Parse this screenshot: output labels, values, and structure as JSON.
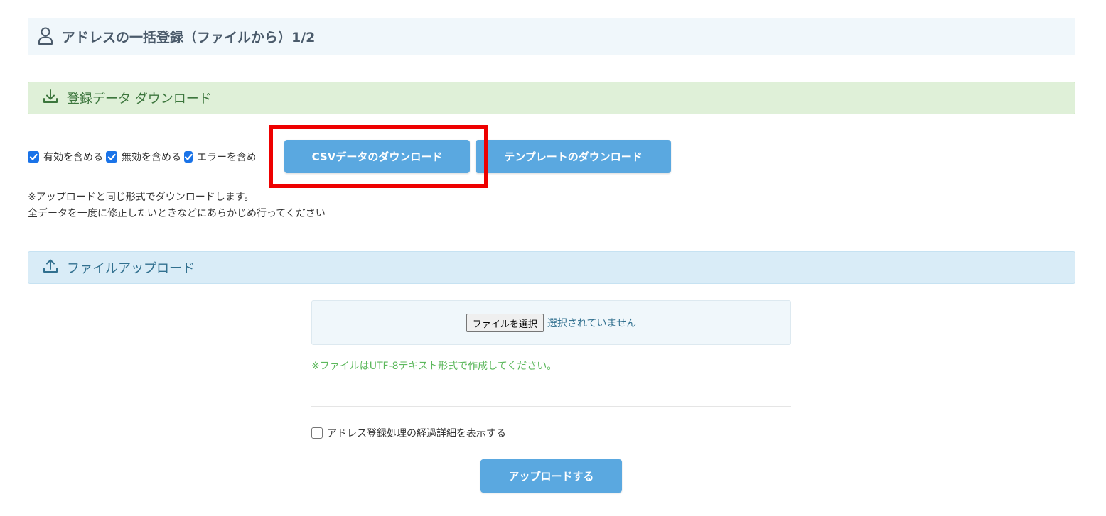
{
  "header": {
    "title": "アドレスの一括登録（ファイルから）1/2",
    "icon": "user-icon"
  },
  "download_section": {
    "title": "登録データ ダウンロード",
    "icon": "download-icon",
    "options": [
      {
        "label": "有効を含める",
        "checked": true
      },
      {
        "label": "無効を含める",
        "checked": true
      },
      {
        "label": "エラーを含める",
        "checked": true
      }
    ],
    "csv_button": "CSVデータのダウンロード",
    "template_button": "テンプレートのダウンロード",
    "note_line1": "※アップロードと同じ形式でダウンロードします。",
    "note_line2": "全データを一度に修正したいときなどにあらかじめ行ってください"
  },
  "upload_section": {
    "title": "ファイルアップロード",
    "icon": "upload-icon",
    "file_button": "ファイルを選択",
    "file_status": "選択されていません",
    "encoding_note": "※ファイルはUTF-8テキスト形式で作成してください。",
    "detail_option": {
      "label": "アドレス登録処理の経過詳細を表示する",
      "checked": false
    },
    "upload_button": "アップロードする"
  },
  "colors": {
    "accent_button": "#5aa8e0",
    "highlight": "#ee0000",
    "download_bg": "#dff0d8",
    "upload_bg": "#d9ecf7",
    "header_bg": "#f0f7fb"
  }
}
